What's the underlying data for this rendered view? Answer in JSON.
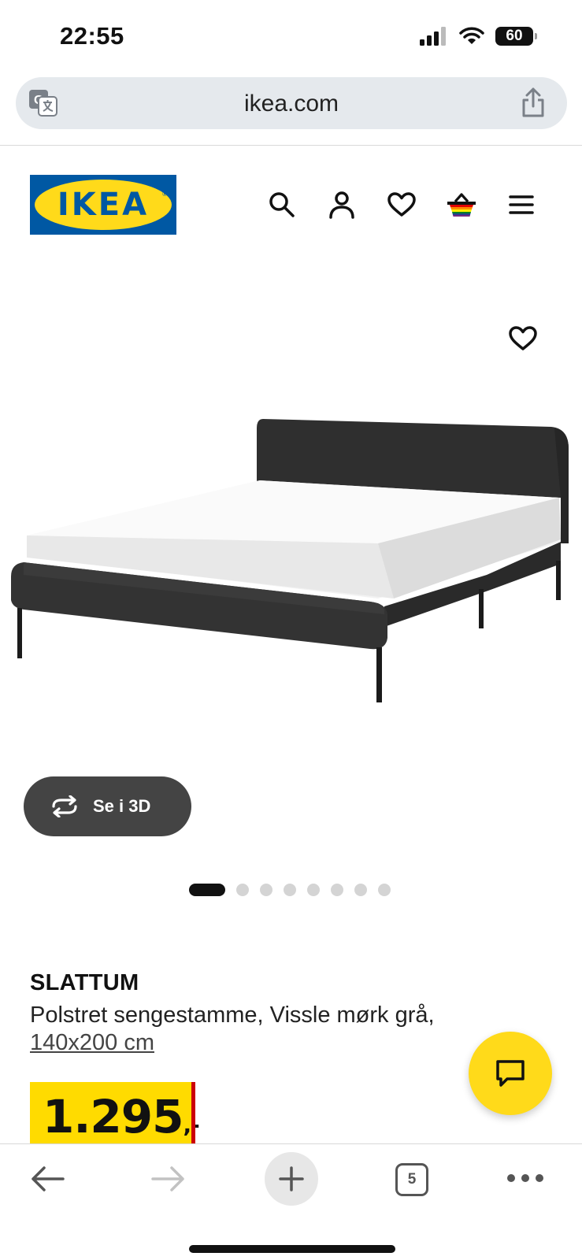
{
  "status_bar": {
    "time": "22:55",
    "battery": "60",
    "icons": [
      "signal-icon",
      "wifi-icon",
      "battery-icon"
    ]
  },
  "browser": {
    "url": "ikea.com",
    "tab_count": "5"
  },
  "header": {
    "logo_text": "IKEA",
    "icons": [
      "search-icon",
      "account-icon",
      "heart-icon",
      "basket-icon",
      "menu-icon"
    ]
  },
  "product": {
    "view_3d_label": "Se i 3D",
    "image_count": 8,
    "active_image_index": 0,
    "name": "SLATTUM",
    "description": "Polstret sengestamme, Vissle mørk grå,",
    "size": "140x200 cm",
    "price": "1.295",
    "price_suffix": ",-"
  },
  "colors": {
    "ikea_blue": "#0058a3",
    "ikea_yellow": "#ffda1a",
    "price_red": "#cc0008",
    "bed_fabric": "#2f2f2f"
  }
}
